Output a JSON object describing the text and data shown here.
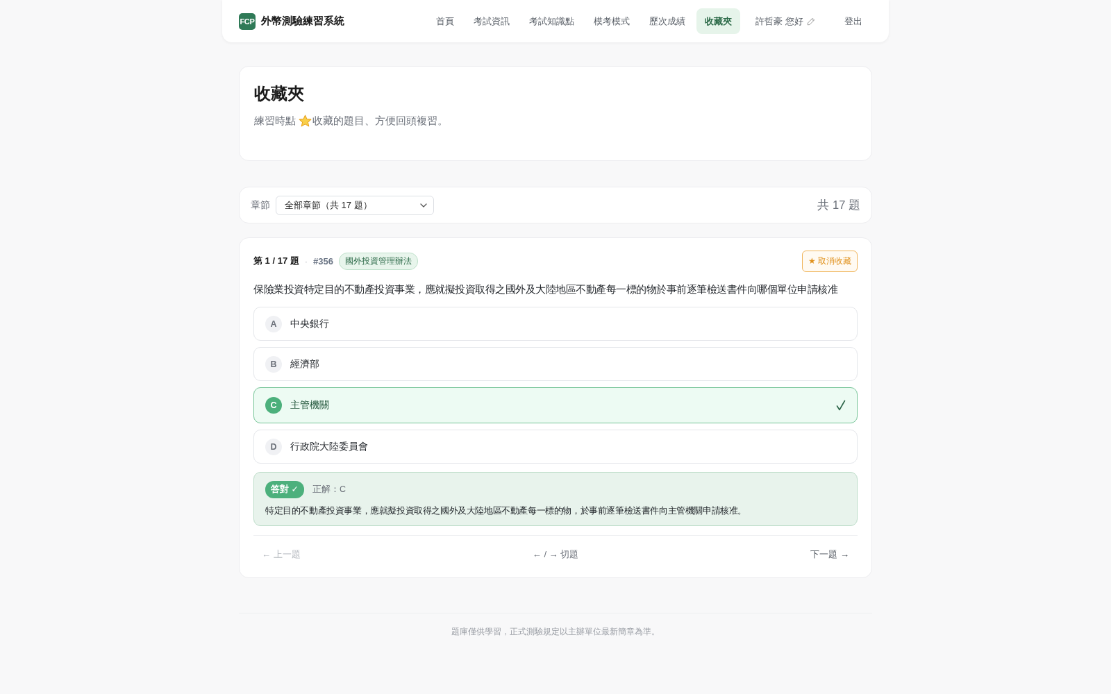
{
  "header": {
    "logo": "FCP",
    "title": "外幣測驗練習系統",
    "nav": [
      {
        "label": "首頁",
        "selected": false
      },
      {
        "label": "考試資訊",
        "selected": false
      },
      {
        "label": "考試知識點",
        "selected": false
      },
      {
        "label": "模考模式",
        "selected": false
      },
      {
        "label": "歷次成績",
        "selected": false
      },
      {
        "label": "收藏夾",
        "selected": true
      }
    ],
    "greeting": "許哲豪 您好",
    "logout": "登出"
  },
  "page": {
    "title": "收藏夾",
    "subtitle_before": "練習時點",
    "subtitle_after": "收藏的題目、方便回頭複習。"
  },
  "filter": {
    "label": "章節",
    "value": "全部章節（共 17 題）",
    "total": "共 17 題"
  },
  "question": {
    "position": "第 1 / 17 題",
    "separator": "·",
    "number": "#356",
    "tag": "國外投資管理辦法",
    "unfavorite_button": "★ 取消收藏",
    "text": "保險業投資特定目的不動產投資事業，應就擬投資取得之國外及大陸地區不動產每一標的物於事前逐筆檢送書件向哪個單位申請核准",
    "options": [
      {
        "letter": "A",
        "text": "中央銀行",
        "correct": false
      },
      {
        "letter": "B",
        "text": "經濟部",
        "correct": false
      },
      {
        "letter": "C",
        "text": "主管機關",
        "correct": true
      },
      {
        "letter": "D",
        "text": "行政院大陸委員會",
        "correct": false
      }
    ]
  },
  "result": {
    "badge": "答對 ✓",
    "answer": "正解：C",
    "explanation": "特定目的不動產投資事業，應就擬投資取得之國外及大陸地區不動產每一標的物，於事前逐筆檢送書件向主管機關申請核准。"
  },
  "navigation": {
    "prev": {
      "label": "← 上一題",
      "disabled": true
    },
    "hint": "← / → 切題",
    "next": {
      "label": "下一題 →",
      "disabled": false
    }
  },
  "footer": "題庫僅供學習，正式測驗規定以主辦單位最新簡章為準。"
}
